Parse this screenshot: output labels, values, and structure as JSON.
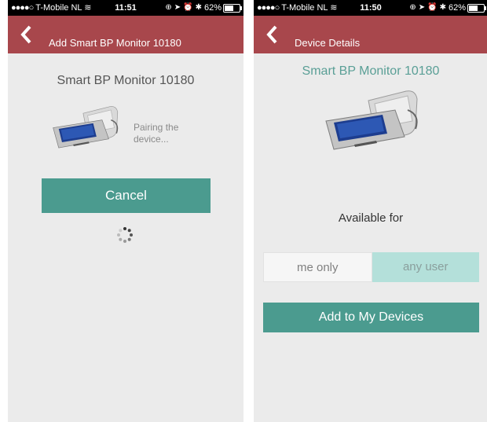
{
  "left_screen": {
    "status_bar": {
      "signal_dots": "●●●●○",
      "carrier": "T-Mobile NL",
      "time": "11:51",
      "battery": "62%",
      "battery_level": 0.62,
      "icons": [
        "wifi-icon",
        "rotation-lock-icon",
        "location-icon",
        "alarm-icon",
        "bluetooth-icon"
      ]
    },
    "nav": {
      "title": "Add Smart BP Monitor 10180",
      "back_icon": "chevron-left-icon"
    },
    "device_title": "Smart BP Monitor 10180",
    "pairing_text": "Pairing the device...",
    "cancel_label": "Cancel",
    "spinner_icon": "loading-spinner-icon"
  },
  "right_screen": {
    "status_bar": {
      "signal_dots": "●●●●○",
      "carrier": "T-Mobile NL",
      "time": "11:50",
      "battery": "62%",
      "battery_level": 0.62,
      "icons": [
        "wifi-icon",
        "rotation-lock-icon",
        "location-icon",
        "alarm-icon",
        "bluetooth-icon"
      ]
    },
    "nav": {
      "title": "Device Details",
      "back_icon": "chevron-left-icon"
    },
    "device_title": "Smart BP Monitor 10180",
    "available_for_label": "Available for",
    "segments": [
      {
        "label": "me only",
        "selected": false
      },
      {
        "label": "any user",
        "selected": true
      }
    ],
    "add_button_label": "Add to My Devices"
  },
  "colors": {
    "nav_bar": "#a8474c",
    "primary_button": "#4b9b8f",
    "selected_segment": "#b4e0da",
    "accent_title": "#5a9f96",
    "screen_background": "#ebebeb"
  }
}
